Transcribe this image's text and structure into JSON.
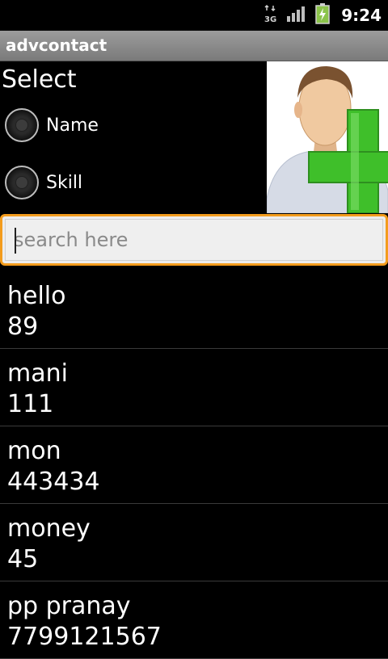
{
  "status_bar": {
    "network": "3G",
    "time": "9:24"
  },
  "app": {
    "title": "advcontact"
  },
  "select": {
    "label": "Select",
    "options": [
      {
        "label": "Name",
        "selected": false
      },
      {
        "label": "Skill",
        "selected": false
      }
    ]
  },
  "search": {
    "placeholder": "search here",
    "value": ""
  },
  "contacts": [
    {
      "name": "hello",
      "number": "89"
    },
    {
      "name": "mani",
      "number": "111"
    },
    {
      "name": "mon",
      "number": "443434"
    },
    {
      "name": "money",
      "number": "45"
    },
    {
      "name": "pp pranay",
      "number": "7799121567"
    }
  ],
  "colors": {
    "focus_border": "#f39c1d",
    "title_bar": "#8a8a8a",
    "plus_green": "#3fbf2a"
  }
}
